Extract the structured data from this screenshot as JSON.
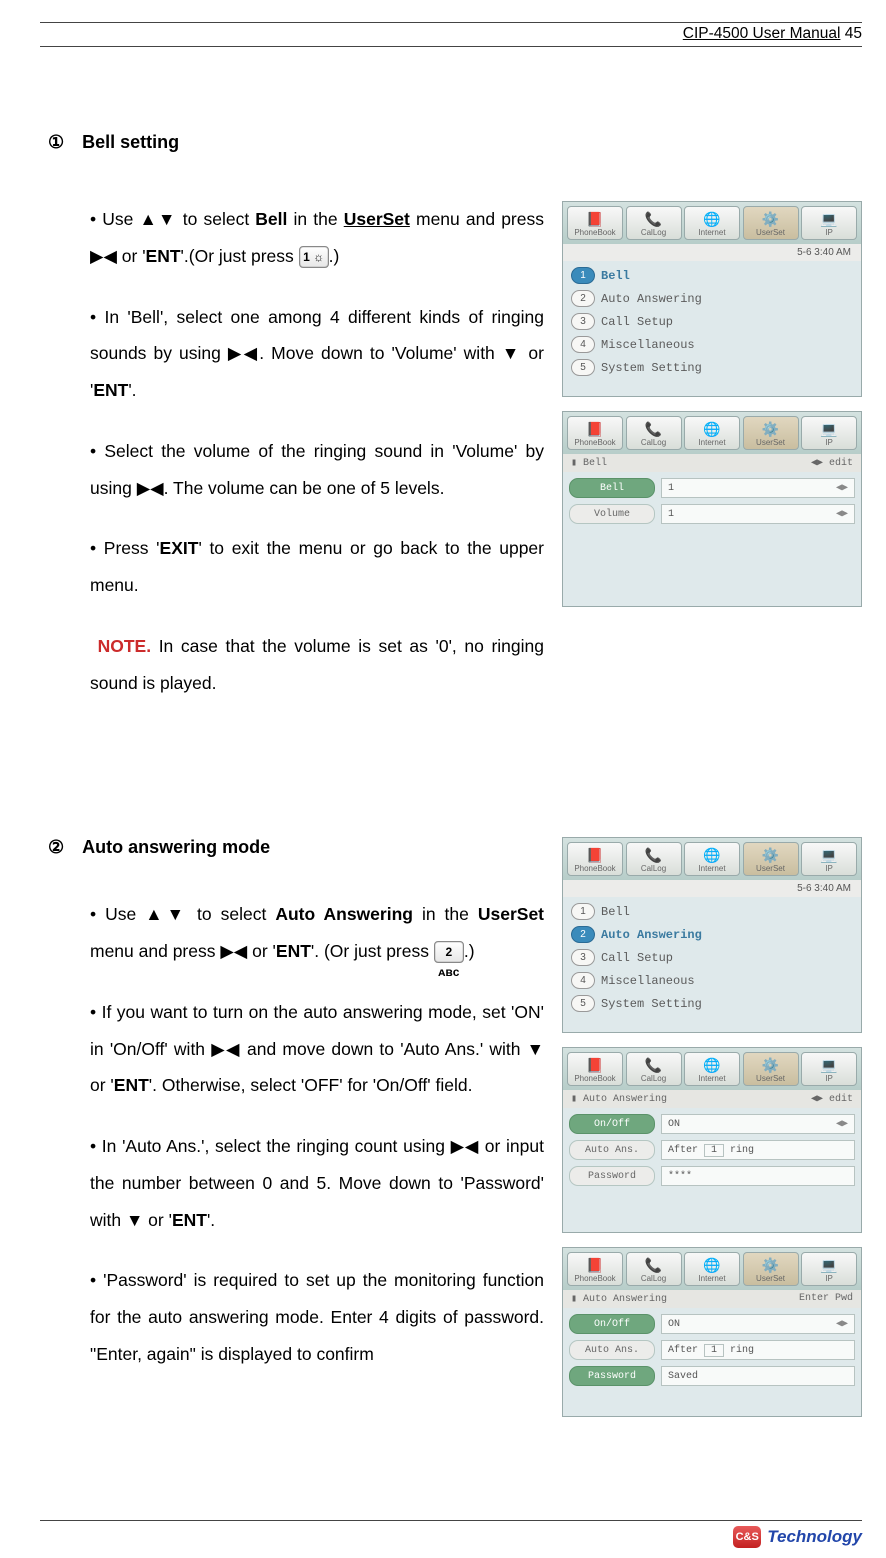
{
  "header": {
    "manual_title": "CIP-4500 User Manual",
    "page_num": "45"
  },
  "section1": {
    "marker": "①",
    "title": "Bell setting",
    "p1a": "• Use ▲▼ to select ",
    "p1b": "Bell",
    "p1c": " in the ",
    "p1d": "UserSet",
    "p1e": " menu and press ▶◀ or '",
    "p1f": "ENT",
    "p1g": "'.(Or just press ",
    "p1h": ".)",
    "key1": "1 ☼",
    "p2a": "• In 'Bell', select one among 4 different kinds of ringing sounds by using ▶◀. Move down to 'Volume' with ▼ or '",
    "p2b": "ENT",
    "p2c": "'.",
    "p3": "• Select the volume of the ringing sound in 'Volume' by using ▶◀. The volume can be one of 5 levels.",
    "p4a": "• Press '",
    "p4b": "EXIT",
    "p4c": "' to exit the menu or go back to the upper menu.",
    "p5a": "NOTE.",
    "p5b": " In case that the volume is set as '0', no ringing sound is played."
  },
  "section2": {
    "marker": "②",
    "title": "Auto answering mode",
    "p1a": "• Use ▲▼ to select ",
    "p1b": "Auto Answering",
    "p1c": " in the ",
    "p1d": "UserSet",
    "p1e": " menu and press ▶◀ or '",
    "p1f": "ENT",
    "p1g": "'. (Or just press ",
    "p1h": ".)",
    "key2": "2 ᴀʙᴄ",
    "p2a": "• If you want to turn on the auto answering mode, set 'ON' in 'On/Off' with ▶◀ and move down to 'Auto Ans.' with ▼ or '",
    "p2b": "ENT",
    "p2c": "'. Otherwise, select 'OFF' for 'On/Off' field.",
    "p3a": "• In 'Auto Ans.', select the ringing count using ▶◀ or input the number between 0 and 5. Move down to 'Password' with ▼ or '",
    "p3b": "ENT",
    "p3c": "'.",
    "p4": "• 'Password' is required to set up the monitoring function for the auto answering mode. Enter 4 digits of password. \"Enter, again\" is displayed to confirm"
  },
  "tabs": {
    "t1": "PhoneBook",
    "t2": "CalLog",
    "t3": "Internet",
    "t4": "UserSet",
    "t5": "IP"
  },
  "ss1": {
    "time": "5-6  3:40 AM",
    "items": [
      "Bell",
      "Auto Answering",
      "Call Setup",
      "Miscellaneous",
      "System Setting"
    ]
  },
  "ss2": {
    "bread": "Bell",
    "bread_r": "◀▶ edit",
    "f1_label": "Bell",
    "f1_val": "1",
    "f2_label": "Volume",
    "f2_val": "1"
  },
  "ss3": {
    "time": "5-6  3:40 AM",
    "items": [
      "Bell",
      "Auto Answering",
      "Call Setup",
      "Miscellaneous",
      "System Setting"
    ],
    "sel_idx": 1
  },
  "ss4": {
    "bread": "Auto Answering",
    "bread_r": "◀▶ edit",
    "f1_label": "On/Off",
    "f1_val": "ON",
    "f2_label": "Auto Ans.",
    "f2_pre": "After",
    "f2_num": "1",
    "f2_post": "ring",
    "f3_label": "Password",
    "f3_val": "****"
  },
  "ss5": {
    "bread": "Auto Answering",
    "bread_r": "Enter Pwd",
    "f1_label": "On/Off",
    "f1_val": "ON",
    "f2_label": "Auto Ans.",
    "f2_pre": "After",
    "f2_num": "1",
    "f2_post": "ring",
    "f3_label": "Password",
    "f3_val": "Saved"
  },
  "footer": {
    "brand": "Technology",
    "badge": "C&S"
  }
}
